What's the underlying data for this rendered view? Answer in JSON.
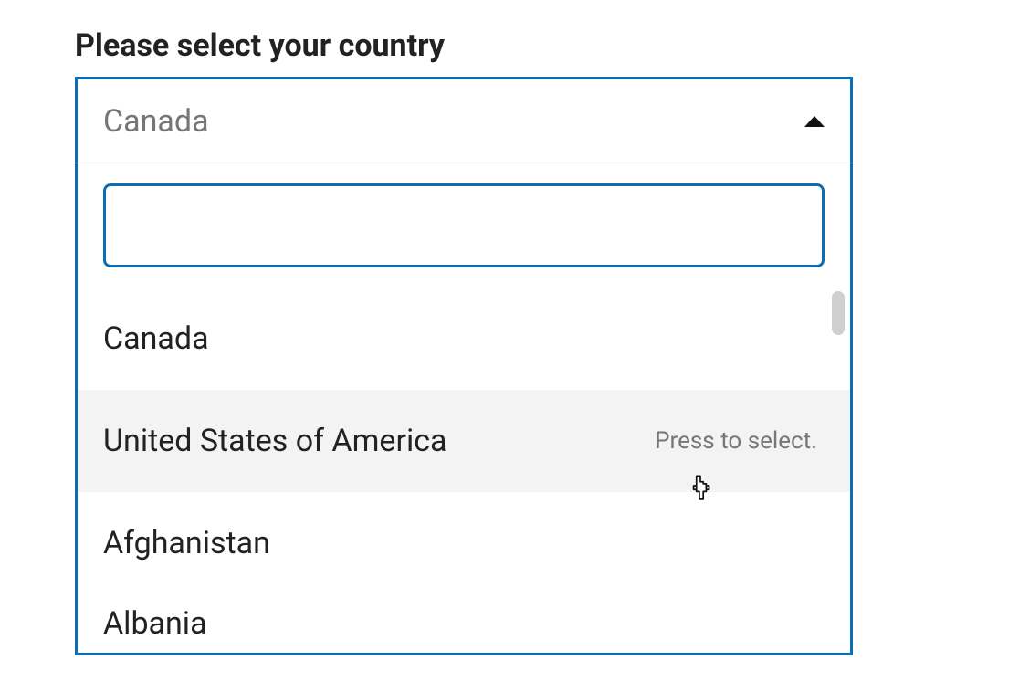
{
  "label": "Please select your country",
  "combobox": {
    "selected": "Canada",
    "search_value": "",
    "hover_hint": "Press to select.",
    "options": [
      "Canada",
      "United States of America",
      "Afghanistan",
      "Albania"
    ]
  },
  "colors": {
    "accent": "#0a6eb4",
    "text": "#222222",
    "text_muted": "#767676",
    "hover_bg": "#f3f3f3",
    "scrollbar": "#cfcfcf",
    "divider": "#c0c0c0"
  }
}
